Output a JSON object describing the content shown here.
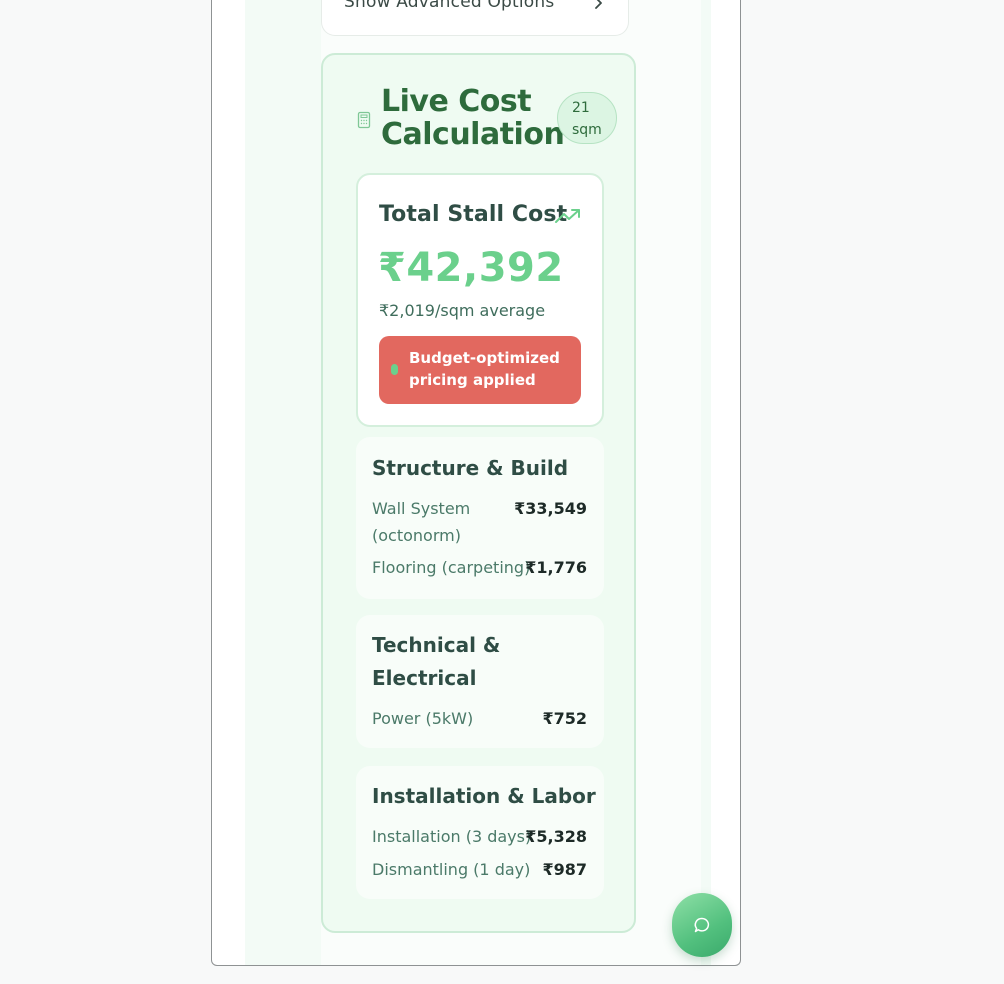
{
  "advanced": {
    "label": "Show Advanced Options"
  },
  "calculation": {
    "title": "Live Cost Calculation",
    "area_value": "21",
    "area_unit": "sqm"
  },
  "total": {
    "title": "Total Stall Cost",
    "amount": "₹42,392",
    "average": "₹2,019/sqm average",
    "budget_note": "Budget-optimized pricing applied"
  },
  "sections": {
    "structure": {
      "title": "Structure & Build",
      "rows": [
        {
          "label": "Wall System (octonorm)",
          "value": "₹33,549"
        },
        {
          "label": "Flooring (carpeting)",
          "value": "₹1,776"
        }
      ]
    },
    "technical": {
      "title": "Technical & Electrical",
      "rows": [
        {
          "label": "Power (5kW)",
          "value": "₹752"
        }
      ]
    },
    "installation": {
      "title": "Installation & Labor",
      "rows": [
        {
          "label": "Installation (3 days)",
          "value": "₹5,328"
        },
        {
          "label": "Dismantling (1 day)",
          "value": "₹987"
        }
      ]
    }
  },
  "colors": {
    "accent_green": "#6bd08c",
    "title_green": "#2e6b3c",
    "budget_red": "#e2685f"
  },
  "icons": [
    "chevron-right-icon",
    "calculator-icon",
    "trending-up-icon",
    "status-dot-icon",
    "chat-icon"
  ]
}
